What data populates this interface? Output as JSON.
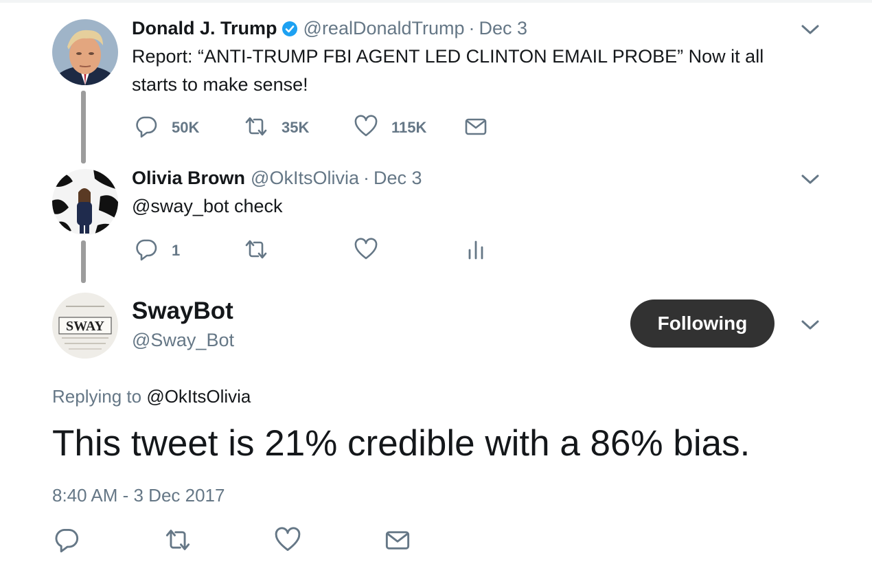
{
  "colors": {
    "text": "#14171a",
    "muted": "#657786",
    "verified": "#1da1f2",
    "thread_line": "#9c9c9c",
    "follow_bg": "#323232"
  },
  "tweets": [
    {
      "name": "Donald J. Trump",
      "verified": true,
      "handle": "@realDonaldTrump",
      "separator": "·",
      "date": "Dec 3",
      "text_line1": "Report: “ANTI-TRUMP FBI AGENT LED CLINTON EMAIL PROBE”  Now it all",
      "text_line2": "starts to make sense!",
      "reply_count": "50K",
      "retweet_count": "35K",
      "like_count": "115K",
      "icons": [
        "reply-icon",
        "retweet-icon",
        "like-icon",
        "message-icon"
      ]
    },
    {
      "name": "Olivia Brown",
      "handle": "@OkItsOlivia",
      "separator": "·",
      "date": "Dec 3",
      "text": "@sway_bot check",
      "reply_count": "1",
      "icons": [
        "reply-icon",
        "retweet-icon",
        "like-icon",
        "analytics-icon"
      ]
    }
  ],
  "swaybot": {
    "avatar_text": "SWAY",
    "name": "SwayBot",
    "handle": "@Sway_Bot",
    "follow_label": "Following",
    "replying_prefix": "Replying to",
    "replying_to": "@OkItsOlivia",
    "text": "This tweet is 21% credible with a 86% bias.",
    "timestamp": "8:40 AM - 3 Dec 2017",
    "icons": [
      "reply-icon",
      "retweet-icon",
      "like-icon",
      "message-icon"
    ]
  }
}
